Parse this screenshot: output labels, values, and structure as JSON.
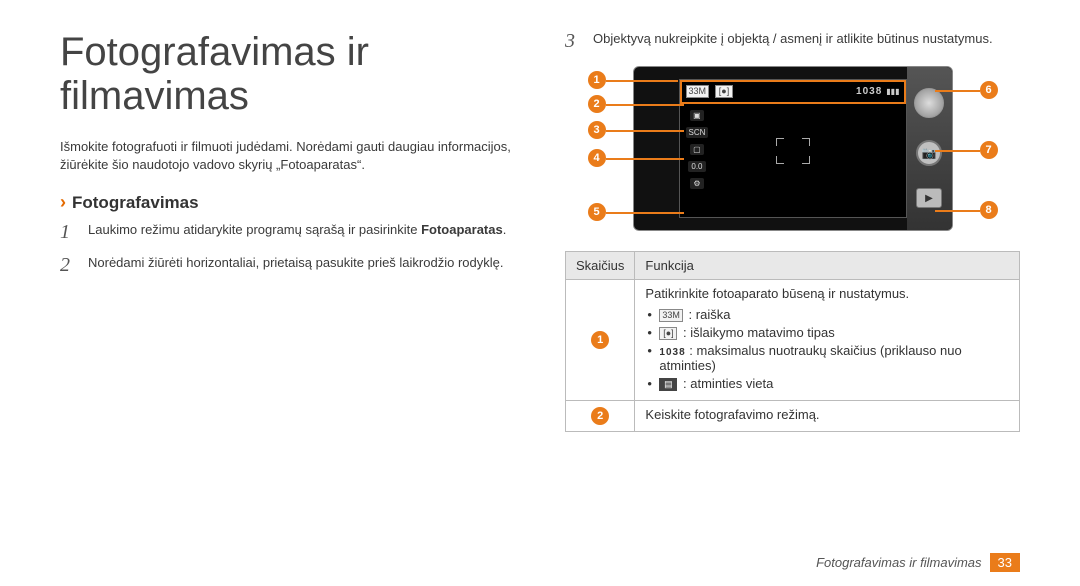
{
  "title": "Fotografavimas ir filmavimas",
  "intro": "Išmokite fotografuoti ir filmuoti judėdami. Norėdami gauti daugiau informacijos, žiūrėkite šio naudotojo vadovo skyrių „Fotoaparatas“.",
  "section": {
    "heading": "Fotografavimas",
    "steps": [
      {
        "num": "1",
        "text_a": "Laukimo režimu atidarykite programų sąrašą ir pasirinkite ",
        "text_b": "Fotoaparatas",
        "text_c": "."
      },
      {
        "num": "2",
        "text_a": "Norėdami žiūrėti horizontaliai, prietaisą pasukite prieš laikrodžio rodyklę."
      },
      {
        "num": "3",
        "text_a": "Objektyvą nukreipkite į objektą / asmenį ir atlikite būtinus nustatymus."
      }
    ]
  },
  "figure": {
    "status_bar": {
      "left_a": "33M",
      "left_b": "[●]",
      "right_a": "1038",
      "right_b": "▮▮▮"
    },
    "left_icons": {
      "mode": "",
      "scn": "SCN",
      "exp_icon": "▢",
      "exp_val": "0.0",
      "gear": "⚙"
    },
    "right_icons": {
      "top": "knob",
      "mid_icon": "📷",
      "play": "▶"
    },
    "callouts": {
      "c1": "1",
      "c2": "2",
      "c3": "3",
      "c4": "4",
      "c5": "5",
      "c6": "6",
      "c7": "7",
      "c8": "8"
    }
  },
  "table": {
    "headers": {
      "num": "Skaičius",
      "func": "Funkcija"
    },
    "rows": [
      {
        "badge": "1",
        "text": "Patikrinkite fotoaparato būseną ir nustatymus.",
        "bullets": [
          {
            "icon_label": "33M",
            "icon_style": "box",
            "text": " : raiška"
          },
          {
            "icon_label": "[●]",
            "icon_style": "box",
            "text": " : išlaikymo matavimo tipas"
          },
          {
            "icon_label": "1038",
            "icon_style": "tiny",
            "text": " : maksimalus nuotraukų skaičius (priklauso nuo atminties)"
          },
          {
            "icon_label": "▤",
            "icon_style": "solid",
            "text": " : atminties vieta"
          }
        ]
      },
      {
        "badge": "2",
        "text": "Keiskite fotografavimo režimą."
      }
    ]
  },
  "footer": {
    "label": "Fotografavimas ir filmavimas",
    "page": "33"
  }
}
